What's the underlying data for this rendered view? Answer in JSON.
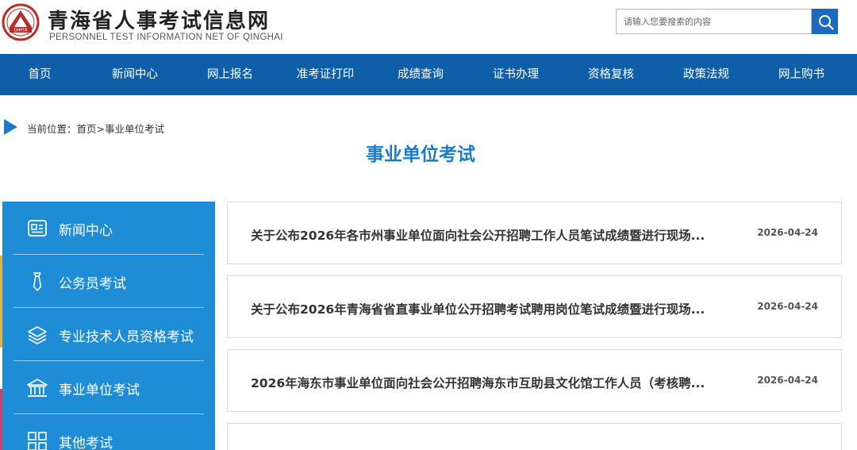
{
  "header": {
    "title": "青海省人事考试信息网",
    "subtitle": "PERSONNEL TEST INFORMATION NET OF QINGHAI",
    "logo_text": "QHPTA",
    "search_placeholder": "请输入您要搜索的内容"
  },
  "nav": {
    "items": [
      {
        "label": "首页"
      },
      {
        "label": "新闻中心"
      },
      {
        "label": "网上报名"
      },
      {
        "label": "准考证打印"
      },
      {
        "label": "成绩查询"
      },
      {
        "label": "证书办理"
      },
      {
        "label": "资格复核"
      },
      {
        "label": "政策法规"
      },
      {
        "label": "网上购书"
      }
    ]
  },
  "breadcrumb": {
    "text": "当前位置：首页>事业单位考试"
  },
  "page_title": "事业单位考试",
  "sidebar": {
    "items": [
      {
        "label": "新闻中心",
        "icon": "newspaper-icon"
      },
      {
        "label": "公务员考试",
        "icon": "tie-icon"
      },
      {
        "label": "专业技术人员资格考试",
        "icon": "layers-icon"
      },
      {
        "label": "事业单位考试",
        "icon": "institution-icon"
      },
      {
        "label": "其他考试",
        "icon": "grid-icon"
      }
    ]
  },
  "news": {
    "items": [
      {
        "title": "关于公布2026年各市州事业单位面向社会公开招聘工作人员笔试成绩暨进行现场...",
        "date": "2026-04-24"
      },
      {
        "title": "关于公布2026年青海省省直事业单位公开招聘考试聘用岗位笔试成绩暨进行现场...",
        "date": "2026-04-24"
      },
      {
        "title": "2026年海东市事业单位面向社会公开招聘海东市互助县文化馆工作人员（考核聘...",
        "date": "2026-04-24"
      }
    ]
  },
  "colors": {
    "nav_bg": "#0e5ea8",
    "sidebar_bg": "#1f8dd6",
    "title_blue": "#1a7cc9",
    "logo_red": "#c0392b"
  }
}
